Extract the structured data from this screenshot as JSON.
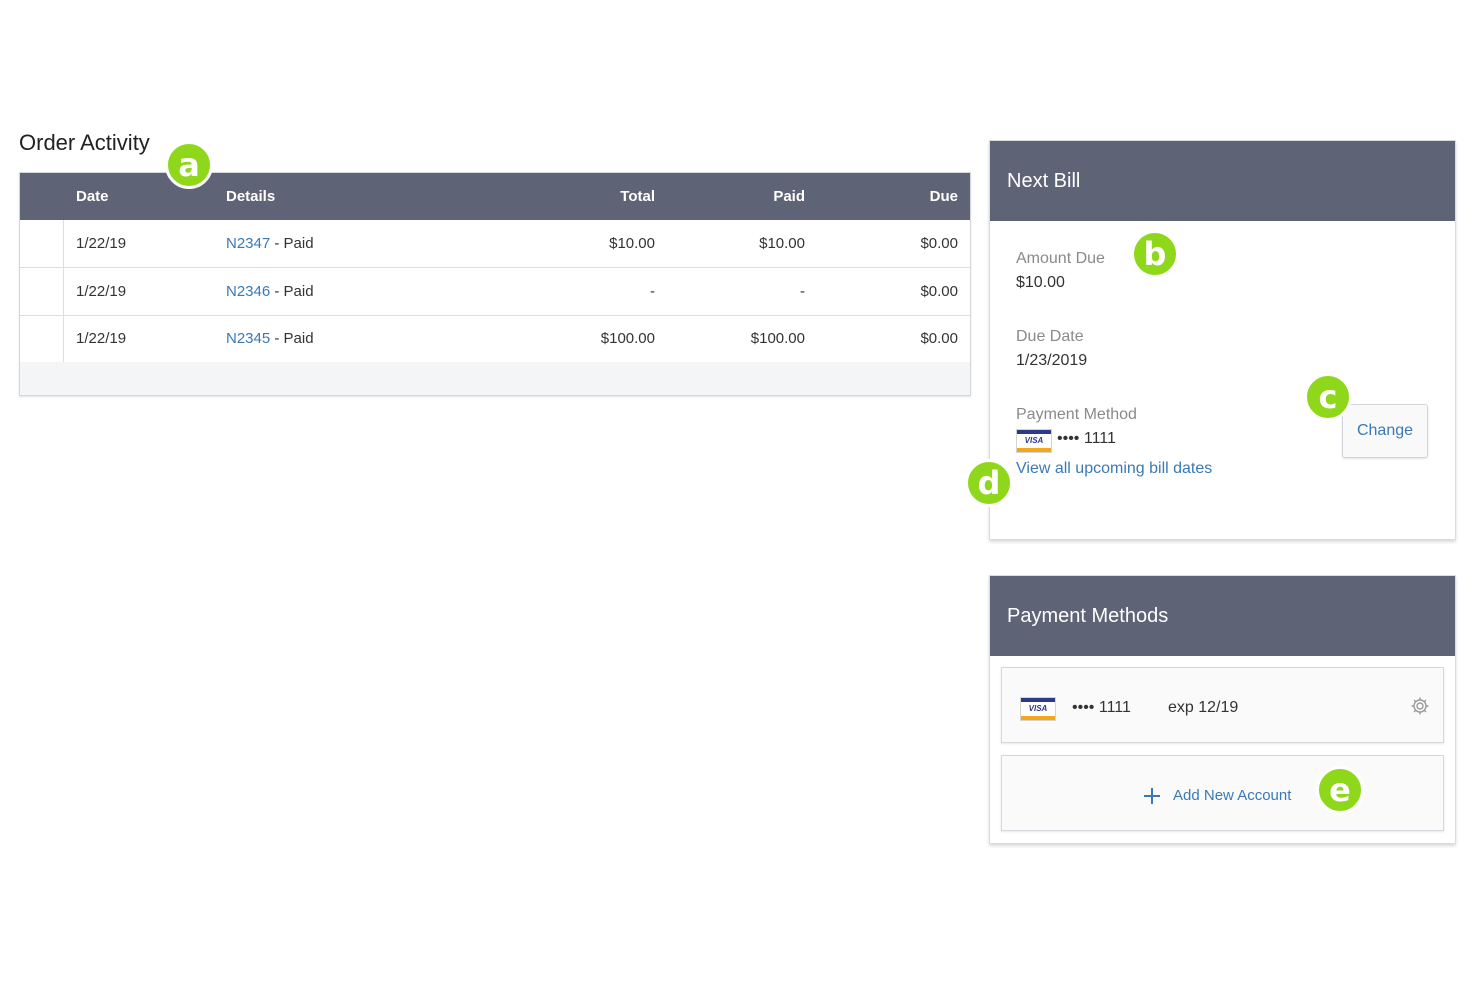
{
  "order_activity": {
    "title": "Order Activity",
    "columns": [
      "Date",
      "Details",
      "Total",
      "Paid",
      "Due"
    ],
    "rows": [
      {
        "date": "1/22/19",
        "order": "N2347",
        "status": "Paid",
        "total": "$10.00",
        "paid": "$10.00",
        "due": "$0.00"
      },
      {
        "date": "1/22/19",
        "order": "N2346",
        "status": "Paid",
        "total": "-",
        "paid": "-",
        "due": "$0.00"
      },
      {
        "date": "1/22/19",
        "order": "N2345",
        "status": "Paid",
        "total": "$100.00",
        "paid": "$100.00",
        "due": "$0.00"
      }
    ],
    "separator": " - "
  },
  "next_bill": {
    "title": "Next Bill",
    "amount_due_label": "Amount Due",
    "amount_due": "$10.00",
    "due_date_label": "Due Date",
    "due_date": "1/23/2019",
    "payment_method_label": "Payment Method",
    "card_brand": "VISA",
    "card_masked": "•••• 1111",
    "change_label": "Change",
    "view_dates_link": "View all upcoming bill dates"
  },
  "payment_methods": {
    "title": "Payment Methods",
    "cards": [
      {
        "brand": "VISA",
        "masked": "•••• 1111",
        "exp": "exp 12/19",
        "icon": "gear-icon"
      }
    ],
    "add_icon": "plus-icon",
    "add_label": "Add New Account"
  },
  "callouts": {
    "a": "a",
    "b": "b",
    "c": "c",
    "d": "d",
    "e": "e"
  },
  "colors": {
    "header_bg": "#5f6376",
    "link": "#3a79b6",
    "callout": "#8fd71a"
  }
}
